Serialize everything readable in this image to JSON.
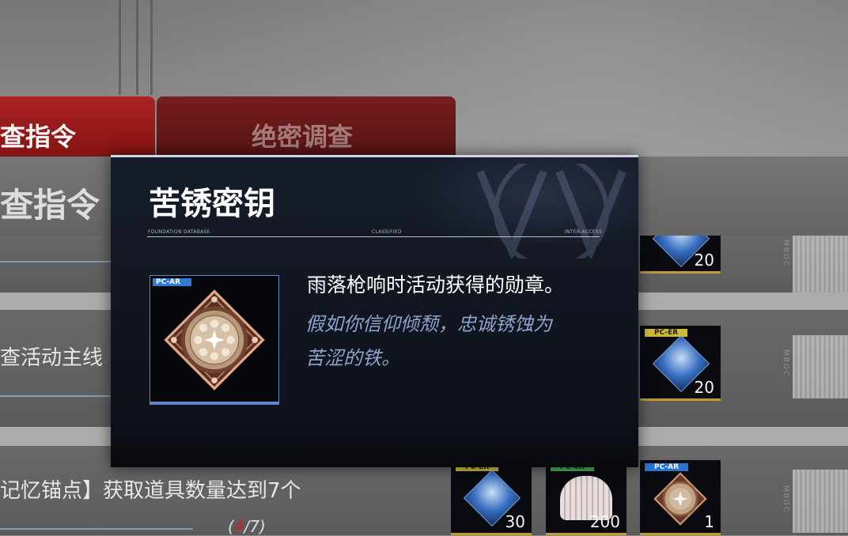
{
  "tabs": [
    {
      "label": "查指令",
      "active": true
    },
    {
      "label": "绝密调查",
      "active": false
    }
  ],
  "section_title": "查指令",
  "tasks": [
    {
      "label": "查活动主线《幺",
      "progress_text": ""
    },
    {
      "label": "记忆锚点】获取道具数量达到7个",
      "progress_current": "4",
      "progress_sep": "/",
      "progress_total": "7",
      "progress_open": "(",
      "progress_close": ")"
    }
  ],
  "rewards": {
    "row1": [
      {
        "tag": "",
        "count": "20"
      }
    ],
    "row2": [
      {
        "tag": "PC-ER",
        "count": "20"
      }
    ],
    "row3": [
      {
        "tag": "PC-ER",
        "count": "30"
      },
      {
        "tag": "PC-CR",
        "count": "200"
      },
      {
        "tag": "PC-AR",
        "count": "1"
      }
    ]
  },
  "side_label": "MBOC",
  "popup": {
    "title": "苦锈密钥",
    "header_left": "FOUNDATION DATABASE",
    "header_mid": "CLASSIFIED",
    "header_right": "INTER-ACCESS",
    "rarity_tag": "PC-AR",
    "icon": "medal-compass-icon",
    "description": "雨落枪响时活动获得的勋章。",
    "lore_line1": "假如你信仰倾颓，忠诚锈蚀为",
    "lore_line2": "苦涩的铁。"
  },
  "colors": {
    "tab_active": "#b32424",
    "tab_inactive": "#7c2020",
    "popup_bg": "#10141d",
    "lore_text": "#8ea4cf",
    "tag_blue": "#2f79d9",
    "tag_yellow": "#d8c13c",
    "tag_green": "#4caf5a",
    "progress_red": "#d8262a"
  }
}
